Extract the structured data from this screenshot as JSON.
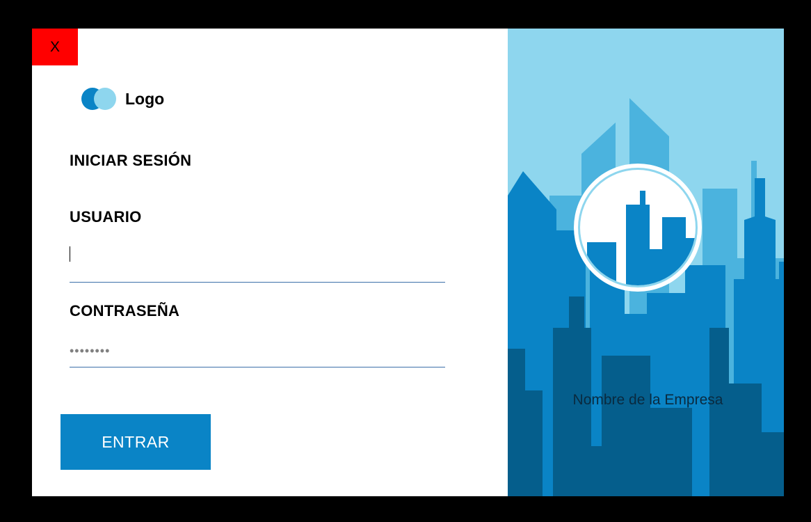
{
  "window": {
    "close_label": "X"
  },
  "logo": {
    "text": "Logo",
    "icon": "overlapping-circles-logo"
  },
  "login": {
    "title": "INICIAR SESIÓN",
    "username_label": "USUARIO",
    "username_value": "",
    "password_label": "CONTRASEÑA",
    "password_value": "••••••••",
    "submit_label": "ENTRAR"
  },
  "branding": {
    "company_name": "Nombre de la Empresa",
    "emblem_icon": "city-skyline-icon"
  },
  "colors": {
    "close_button": "#ff0000",
    "accent": "#0a84c6",
    "field_underline": "#3b6fa8",
    "sky": "#8ed6ee",
    "building_light": "#4bb3de",
    "building_mid": "#0a84c6",
    "building_dark": "#055e8c"
  }
}
